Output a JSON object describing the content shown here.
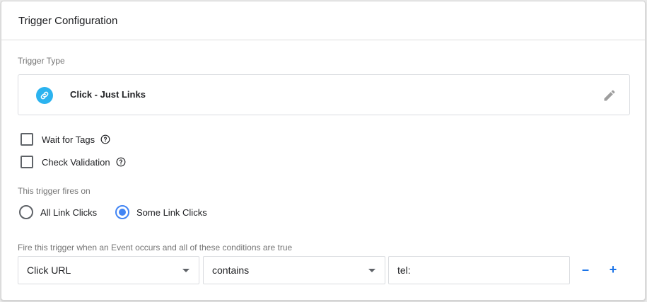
{
  "header": {
    "title": "Trigger Configuration"
  },
  "trigger_type": {
    "label": "Trigger Type",
    "name": "Click - Just Links",
    "icon": "link-icon",
    "icon_color": "#2bb3ef"
  },
  "options": {
    "wait_for_tags": {
      "label": "Wait for Tags",
      "checked": false
    },
    "check_validation": {
      "label": "Check Validation",
      "checked": false
    }
  },
  "fires_on": {
    "label": "This trigger fires on",
    "choices": [
      {
        "label": "All Link Clicks",
        "selected": false
      },
      {
        "label": "Some Link Clicks",
        "selected": true
      }
    ]
  },
  "conditions": {
    "label": "Fire this trigger when an Event occurs and all of these conditions are true",
    "rows": [
      {
        "variable": "Click URL",
        "operator": "contains",
        "value": "tel:"
      }
    ],
    "remove_label": "–",
    "add_label": "+"
  },
  "colors": {
    "accent": "#4285f4",
    "link_blue": "#1a73e8"
  }
}
